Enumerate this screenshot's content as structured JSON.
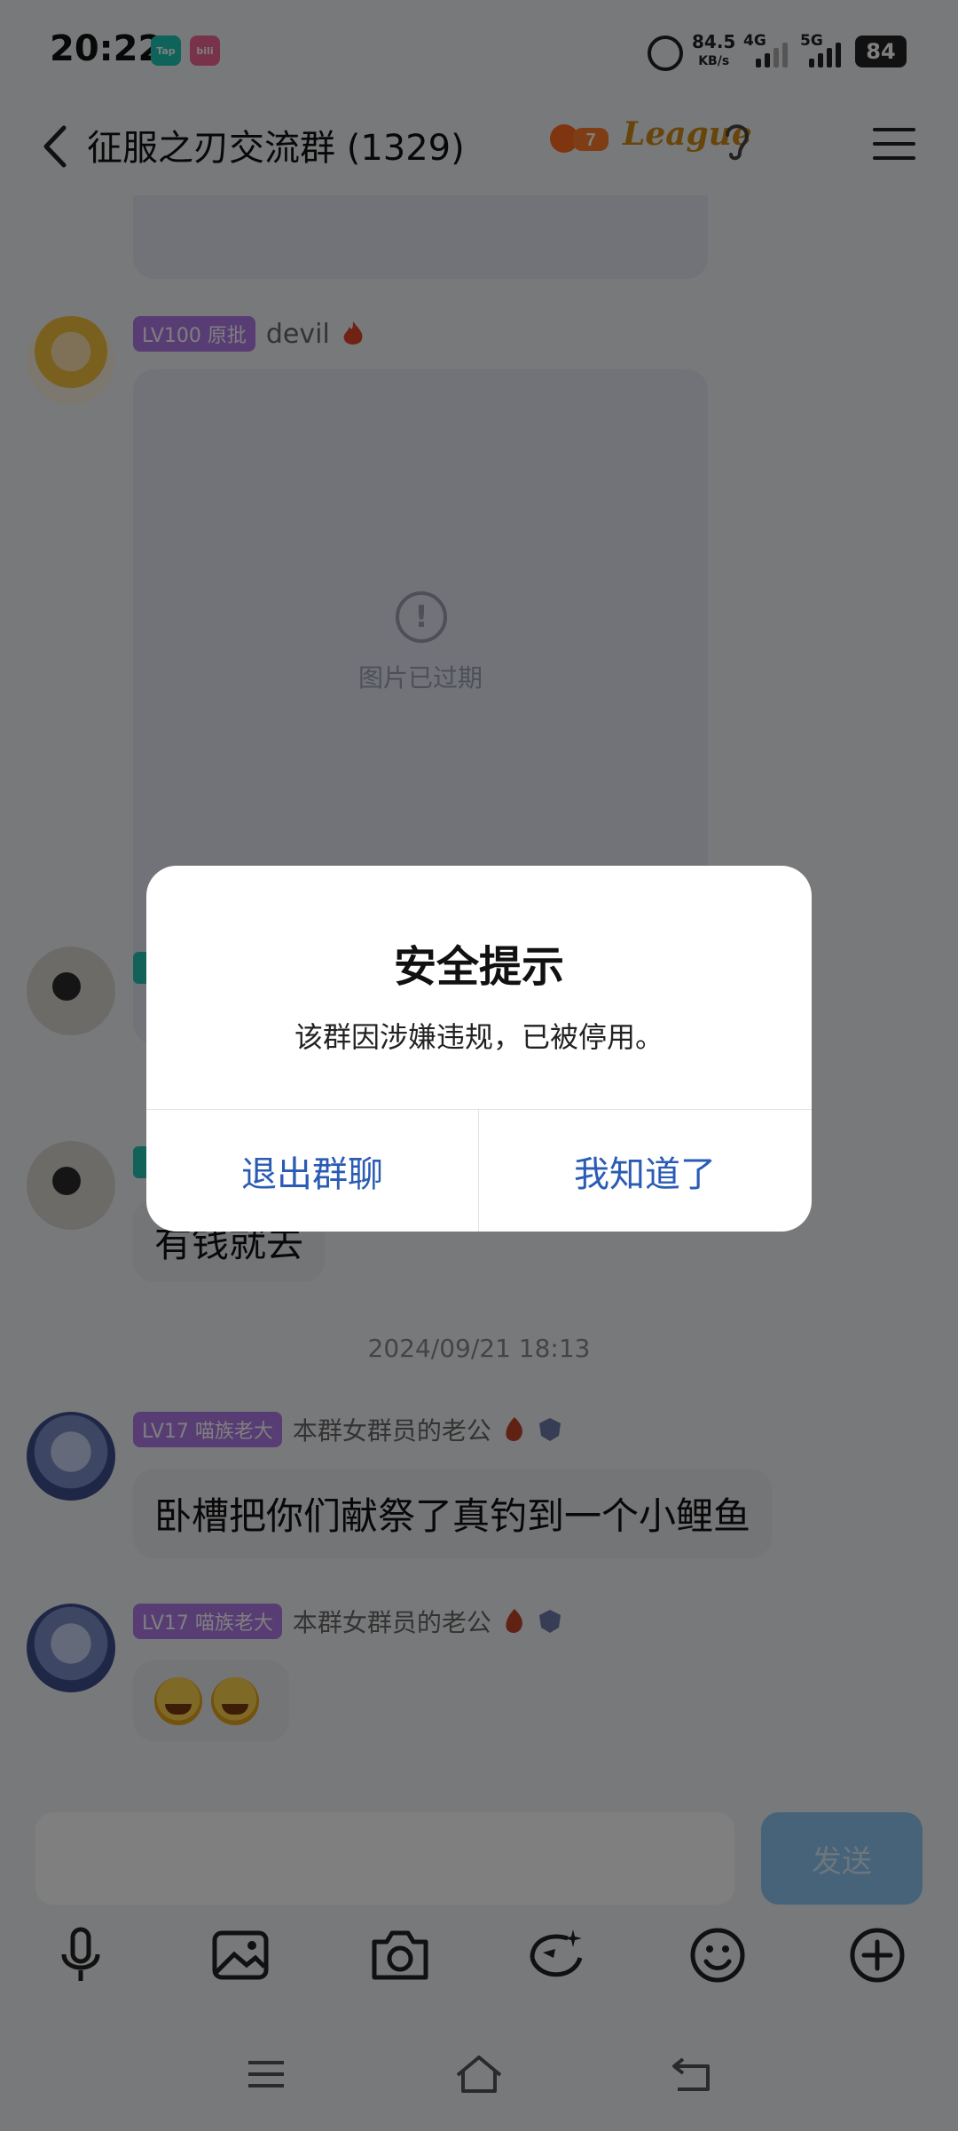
{
  "status_bar": {
    "time": "20:22",
    "app_badges": [
      "Tap",
      "bilibili"
    ],
    "net_speed": "84.5",
    "net_speed_unit": "KB/s",
    "network_1": "4G",
    "network_2": "5G",
    "battery": "84"
  },
  "header": {
    "title": "征服之刃交流群 (1329)",
    "fire_level": "7",
    "league_badge": "League"
  },
  "messages": [
    {
      "level": "LV100 原批",
      "name": "devil",
      "expired_text": "图片已过期"
    },
    {
      "text": "有钱就去"
    },
    {
      "level": "LV17 喵族老大",
      "name": "本群女群员的老公",
      "text": "卧槽把你们献祭了真钓到一个小鲤鱼"
    },
    {
      "level": "LV17 喵族老大",
      "name": "本群女群员的老公"
    }
  ],
  "timestamp": "2024/09/21 18:13",
  "input": {
    "send_label": "发送"
  },
  "dialog": {
    "title": "安全提示",
    "message": "该群因涉嫌违规，已被停用。",
    "exit_label": "退出群聊",
    "ok_label": "我知道了"
  }
}
